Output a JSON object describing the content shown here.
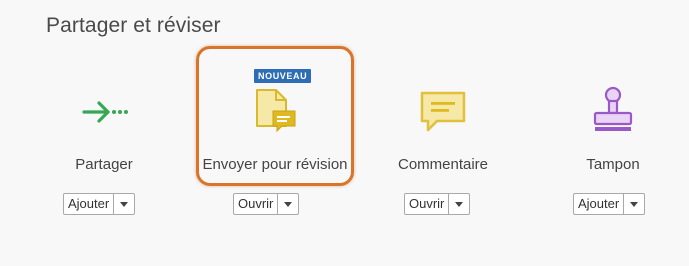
{
  "section": {
    "title": "Partager et réviser"
  },
  "tools": {
    "partager": {
      "label": "Partager",
      "icon": "share-arrow-icon",
      "button": "Ajouter"
    },
    "envoyer": {
      "label": "Envoyer pour révision",
      "icon": "send-for-review-icon",
      "badge": "NOUVEAU",
      "button": "Ouvrir"
    },
    "commentaire": {
      "label": "Commentaire",
      "icon": "comment-icon",
      "button": "Ouvrir"
    },
    "tampon": {
      "label": "Tampon",
      "icon": "stamp-icon",
      "button": "Ajouter"
    }
  },
  "colors": {
    "share_green": "#34a853",
    "review_yellow": "#d9b92c",
    "comment_yellow": "#e0c03c",
    "stamp_purple": "#9b59c8",
    "highlight_orange": "#d9752a",
    "badge_blue": "#2d6db5"
  }
}
